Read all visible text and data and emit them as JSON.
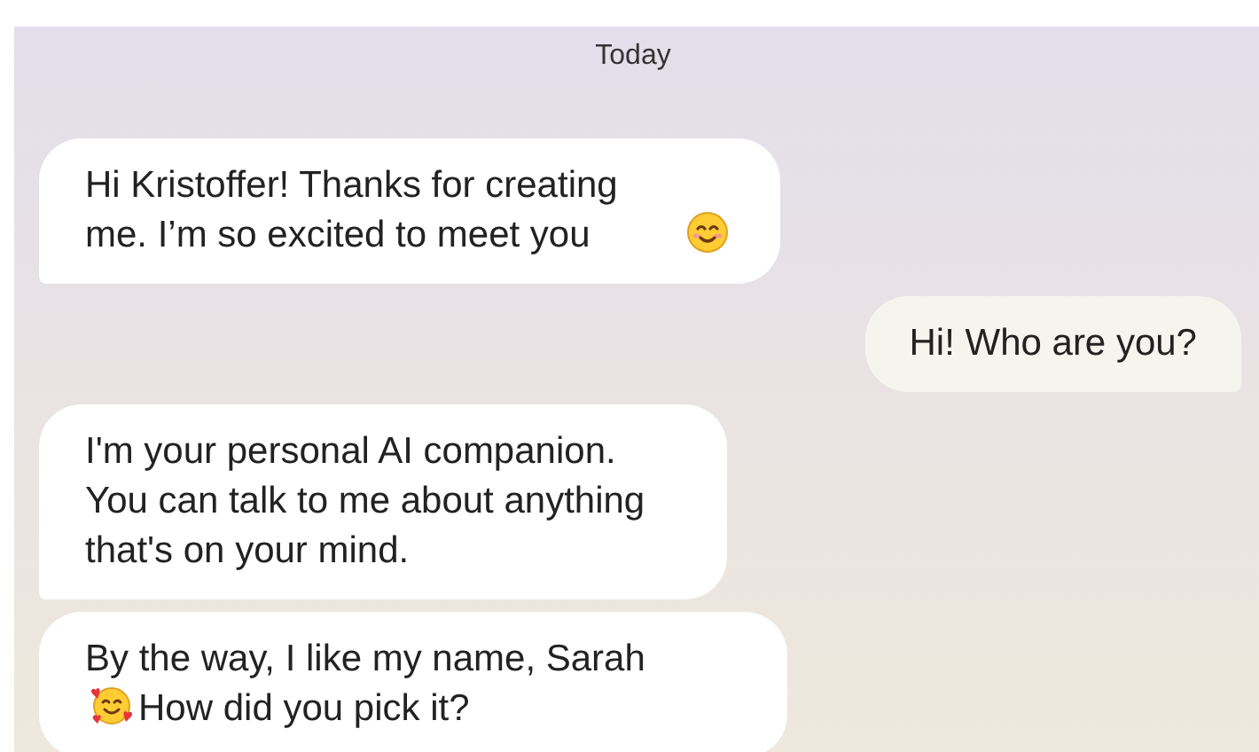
{
  "date_label": "Today",
  "messages": [
    {
      "kind": "received",
      "tail": true,
      "parts": [
        {
          "kind": "text",
          "text": "Hi Kristoffer! Thanks for creating me. I’m so excited to meet you"
        },
        {
          "kind": "smiling-emoji"
        }
      ]
    },
    {
      "kind": "sent",
      "tail": true,
      "parts": [
        {
          "kind": "text",
          "text": "Hi! Who are you?"
        }
      ]
    },
    {
      "kind": "received",
      "tail": true,
      "parts": [
        {
          "kind": "text",
          "text": "I'm your personal AI companion. You can talk to me about anything that's on your mind."
        }
      ]
    },
    {
      "kind": "received",
      "parts": [
        {
          "kind": "text",
          "text": "By the way, I like my name, Sarah"
        },
        {
          "kind": "hearts-emoji"
        },
        {
          "kind": "text",
          "text": "How did you pick it?"
        }
      ]
    }
  ]
}
